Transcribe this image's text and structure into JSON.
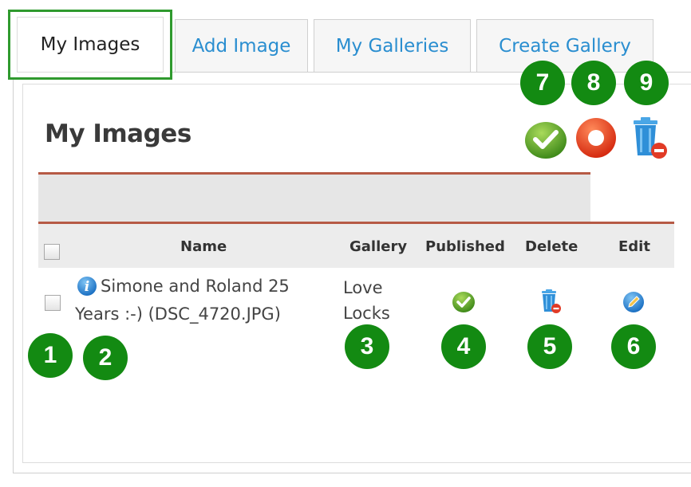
{
  "tabs": [
    {
      "label": "My Images",
      "active": true
    },
    {
      "label": "Add Image",
      "active": false
    },
    {
      "label": "My Galleries",
      "active": false
    },
    {
      "label": "Create Gallery",
      "active": false
    }
  ],
  "page": {
    "title": "My Images"
  },
  "toolbar": {
    "badges": [
      "7",
      "8",
      "9"
    ],
    "actions": [
      {
        "icon": "publish-check-icon",
        "color": "#5aa12a"
      },
      {
        "icon": "unpublish-circle-icon",
        "color": "#e8411e"
      },
      {
        "icon": "trash-delete-icon",
        "color": "#2f8fd8"
      }
    ]
  },
  "table": {
    "columns": [
      "Name",
      "Gallery",
      "Published",
      "Delete",
      "Edit"
    ],
    "rows": [
      {
        "name_line1": "Simone and Roland 25",
        "name_line2": "Years :-) (DSC_4720.JPG)",
        "gallery_line1": "Love",
        "gallery_line2": "Locks",
        "published": true
      }
    ]
  },
  "row_badges": [
    "1",
    "2",
    "3",
    "4",
    "5",
    "6"
  ],
  "colors": {
    "badge": "#138a12",
    "accent_rule": "#b65a45",
    "link": "#2a8ed0",
    "active_tab_border": "#2f9a2e"
  }
}
